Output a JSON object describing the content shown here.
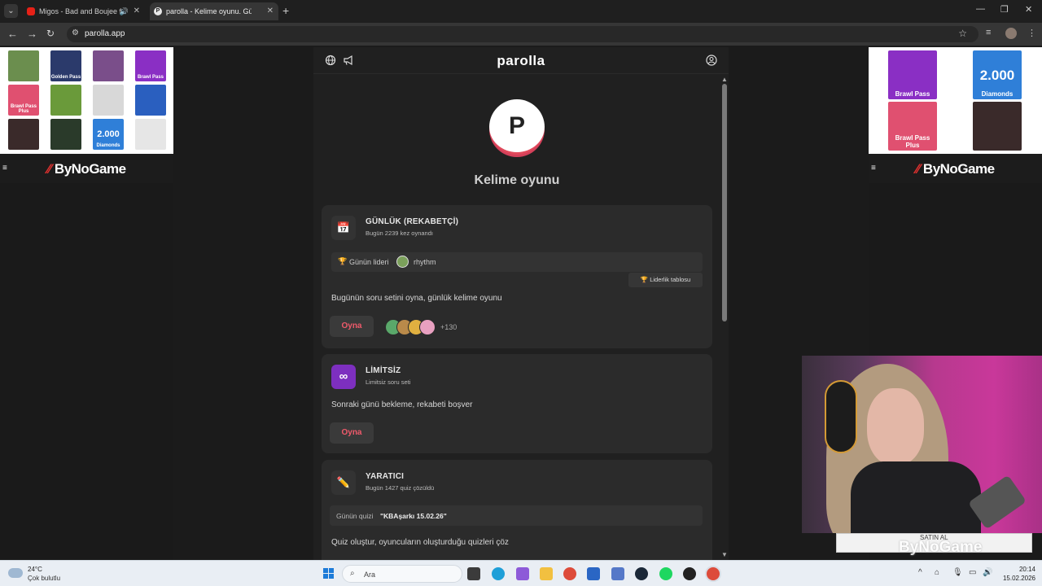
{
  "browser": {
    "tabs": [
      {
        "title": "Migos - Bad and Boujee ft. L",
        "audio": "🔊",
        "close": "✕"
      },
      {
        "title": "parolla - Kelime oyunu. Günlük",
        "favicon": "P",
        "close": "✕"
      }
    ],
    "new_tab": "+",
    "url": "parolla.app",
    "window_controls": [
      "—",
      "❐",
      "✕"
    ]
  },
  "ads": {
    "brand_left": "ByNoGame",
    "brand_right": "ByNoGame",
    "menu_icon": "≡",
    "left_products": [
      {
        "label": "",
        "color": "#6b8e4e"
      },
      {
        "label": "Golden Pass",
        "color": "#2b3a6b"
      },
      {
        "label": "",
        "color": "#7a4e8a"
      },
      {
        "label": "Brawl Pass",
        "color": "#8a2fc4"
      },
      {
        "label": "Brawl Pass Plus",
        "color": "#e05070"
      },
      {
        "label": "",
        "color": "#6a9a3a"
      },
      {
        "label": "",
        "color": "#d8d8d8"
      },
      {
        "label": "",
        "color": "#2a5fbf"
      },
      {
        "label": "",
        "color": "#3a2a2a"
      },
      {
        "label": "",
        "color": "#2a3a2a"
      },
      {
        "label": "Diamonds",
        "value": "2.000",
        "color": "#2f7fd8"
      },
      {
        "label": "",
        "color": "#e6e6e6"
      }
    ],
    "right_products": [
      {
        "label": "Brawl Pass",
        "color": "#8a2fc4"
      },
      {
        "label": "Diamonds",
        "value": "2.000",
        "color": "#2f7fd8"
      },
      {
        "label": "Brawl Pass Plus",
        "color": "#e05070"
      },
      {
        "label": "",
        "color": "#3a2a2a"
      }
    ]
  },
  "app": {
    "brand": "parolla",
    "logo_letter": "P",
    "title": "Kelime oyunu",
    "cards": {
      "daily": {
        "icon": "📅",
        "title": "GÜNLÜK (REKABETÇİ)",
        "subtitle": "Bugün 2239 kez oynandı",
        "leader_label": "Günün lideri",
        "leader_name": "rhythm",
        "leaderboard_button": "🏆 Liderlik tablosu",
        "description": "Bugünün soru setini oyna, günlük kelime oyunu",
        "play": "Oyna",
        "players_extra": "+130",
        "player_colors": [
          "#5aa86a",
          "#b98a4a",
          "#e0b040",
          "#e8a0c0"
        ]
      },
      "unlimited": {
        "icon": "∞",
        "title": "LİMİTSİZ",
        "subtitle": "Limitsiz soru seti",
        "description": "Sonraki günü bekleme, rekabeti boşver",
        "play": "Oyna"
      },
      "creator": {
        "icon": "✏️",
        "title": "YARATICI",
        "subtitle": "Bugün 1427 quiz çözüldü",
        "quiz_label": "Günün quizi",
        "quiz_value": "\"KBAşarkı 15.02.26\"",
        "description": "Quiz oluştur, oyuncuların oluşturduğu quizleri çöz"
      }
    }
  },
  "webcam": {
    "buy_label": "SATIN AL",
    "watermark": "ByNoGame"
  },
  "taskbar": {
    "weather_temp": "24°C",
    "weather_desc": "Çok bulutlu",
    "search_label": "Ara",
    "time": "20:14",
    "date": "15.02.2026"
  }
}
